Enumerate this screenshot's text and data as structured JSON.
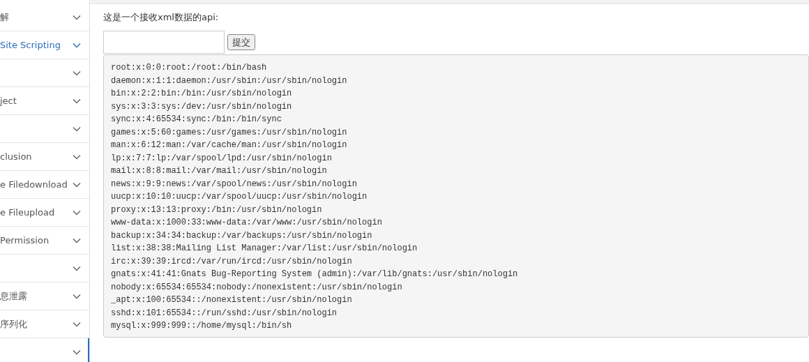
{
  "sidebar": {
    "items": [
      {
        "label": "解",
        "highlighted": false,
        "selected": false
      },
      {
        "label": "Site Scripting",
        "highlighted": true,
        "selected": false
      },
      {
        "highlighted": false,
        "selected": false
      },
      {
        "label": "ject",
        "highlighted": false,
        "selected": false
      },
      {
        "highlighted": false,
        "selected": false
      },
      {
        "label": "clusion",
        "highlighted": false,
        "selected": false
      },
      {
        "label": "e Filedownload",
        "highlighted": false,
        "selected": false
      },
      {
        "label": "e Fileupload",
        "highlighted": false,
        "selected": false
      },
      {
        "label": "Permission",
        "highlighted": false,
        "selected": false
      },
      {
        "highlighted": false,
        "selected": false
      },
      {
        "label": "息泄露",
        "highlighted": false,
        "selected": false
      },
      {
        "label": "序列化",
        "highlighted": false,
        "selected": false
      },
      {
        "highlighted": false,
        "selected": true
      }
    ]
  },
  "content": {
    "intro": "这是一个接收xml数据的api:",
    "submit_button": "提交",
    "output_lines": [
      "root:x:0:0:root:/root:/bin/bash",
      "daemon:x:1:1:daemon:/usr/sbin:/usr/sbin/nologin",
      "bin:x:2:2:bin:/bin:/usr/sbin/nologin",
      "sys:x:3:3:sys:/dev:/usr/sbin/nologin",
      "sync:x:4:65534:sync:/bin:/bin/sync",
      "games:x:5:60:games:/usr/games:/usr/sbin/nologin",
      "man:x:6:12:man:/var/cache/man:/usr/sbin/nologin",
      "lp:x:7:7:lp:/var/spool/lpd:/usr/sbin/nologin",
      "mail:x:8:8:mail:/var/mail:/usr/sbin/nologin",
      "news:x:9:9:news:/var/spool/news:/usr/sbin/nologin",
      "uucp:x:10:10:uucp:/var/spool/uucp:/usr/sbin/nologin",
      "proxy:x:13:13:proxy:/bin:/usr/sbin/nologin",
      "www-data:x:1000:33:www-data:/var/www:/usr/sbin/nologin",
      "backup:x:34:34:backup:/var/backups:/usr/sbin/nologin",
      "list:x:38:38:Mailing List Manager:/var/list:/usr/sbin/nologin",
      "irc:x:39:39:ircd:/var/run/ircd:/usr/sbin/nologin",
      "gnats:x:41:41:Gnats Bug-Reporting System (admin):/var/lib/gnats:/usr/sbin/nologin",
      "nobody:x:65534:65534:nobody:/nonexistent:/usr/sbin/nologin",
      "_apt:x:100:65534::/nonexistent:/usr/sbin/nologin",
      "sshd:x:101:65534::/run/sshd:/usr/sbin/nologin",
      "mysql:x:999:999::/home/mysql:/bin/sh"
    ]
  }
}
